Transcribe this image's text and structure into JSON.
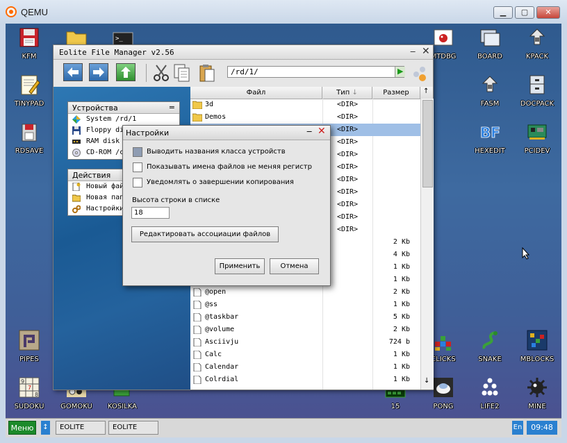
{
  "host": {
    "title": "QEMU",
    "min_glyph": "▁",
    "max_glyph": "▢",
    "close_glyph": "✕"
  },
  "desktop_icons": [
    {
      "label": "KFM",
      "icon": "floppy-icon"
    },
    {
      "label": "TINYPAD",
      "icon": "notepad-icon"
    },
    {
      "label": "RDSAVE",
      "icon": "save-icon"
    },
    {
      "label": "PIPES",
      "icon": "pipes-icon"
    },
    {
      "label": "SUDOKU",
      "icon": "sudoku-icon"
    },
    {
      "label": "GOMOKU",
      "icon": "gomoku-icon"
    },
    {
      "label": "KOSILKA",
      "icon": "kosilka-icon"
    },
    {
      "label": "MTDBG",
      "icon": "debugger-icon"
    },
    {
      "label": "BOARD",
      "icon": "board-icon"
    },
    {
      "label": "KPACK",
      "icon": "kpack-icon"
    },
    {
      "label": "FASM",
      "icon": "fasm-icon"
    },
    {
      "label": "DOCPACK",
      "icon": "docpack-icon"
    },
    {
      "label": "HEXEDIT",
      "icon": "hexedit-icon"
    },
    {
      "label": "PCIDEV",
      "icon": "pcidev-icon"
    },
    {
      "label": "CLICKS",
      "icon": "clicks-icon"
    },
    {
      "label": "SNAKE",
      "icon": "snake-icon"
    },
    {
      "label": "MBLOCKS",
      "icon": "mblocks-icon"
    },
    {
      "label": "15",
      "icon": "fifteen-icon"
    },
    {
      "label": "PONG",
      "icon": "pong-icon"
    },
    {
      "label": "LIFE2",
      "icon": "life-icon"
    },
    {
      "label": "MINE",
      "icon": "mine-icon"
    }
  ],
  "fm": {
    "title": "Eolite File Manager v2.56",
    "min_glyph": "‒",
    "close_glyph": "✕",
    "path": "/rd/1/",
    "devices": {
      "header": "Устройства",
      "menu_glyph": "=",
      "items": [
        {
          "label": "System /rd/1",
          "icon": "system-icon"
        },
        {
          "label": "Floppy disk",
          "icon": "floppy-icon"
        },
        {
          "label": "RAM disk",
          "icon": "ramdisk-icon"
        },
        {
          "label": "CD-ROM /cd",
          "icon": "cdrom-icon"
        }
      ]
    },
    "actions": {
      "header": "Действия",
      "items": [
        {
          "label": "Новый файл",
          "icon": "new-file-icon"
        },
        {
          "label": "Новая папка",
          "icon": "new-folder-icon"
        },
        {
          "label": "Настройки",
          "icon": "settings-icon"
        }
      ]
    },
    "columns": {
      "name": "Файл",
      "type": "Тип",
      "sort_glyph": "↓",
      "size": "Размер"
    },
    "scroll_up": "↑",
    "scroll_down": "↓",
    "files": [
      {
        "name": "3d",
        "type": "<DIR>",
        "size": "",
        "kind": "folder",
        "selected": false
      },
      {
        "name": "Demos",
        "type": "<DIR>",
        "size": "",
        "kind": "folder",
        "selected": false
      },
      {
        "name": "",
        "type": "<DIR>",
        "size": "",
        "kind": "folder",
        "selected": true
      },
      {
        "name": "",
        "type": "<DIR>",
        "size": "",
        "kind": "folder",
        "selected": false
      },
      {
        "name": "",
        "type": "<DIR>",
        "size": "",
        "kind": "folder",
        "selected": false
      },
      {
        "name": "",
        "type": "<DIR>",
        "size": "",
        "kind": "folder",
        "selected": false
      },
      {
        "name": "",
        "type": "<DIR>",
        "size": "",
        "kind": "folder",
        "selected": false
      },
      {
        "name": "",
        "type": "<DIR>",
        "size": "",
        "kind": "folder",
        "selected": false
      },
      {
        "name": "",
        "type": "<DIR>",
        "size": "",
        "kind": "folder",
        "selected": false
      },
      {
        "name": "",
        "type": "<DIR>",
        "size": "",
        "kind": "folder",
        "selected": false
      },
      {
        "name": "",
        "type": "<DIR>",
        "size": "",
        "kind": "folder",
        "selected": false
      },
      {
        "name": "",
        "type": "",
        "size": "2 Kb",
        "kind": "file",
        "selected": false
      },
      {
        "name": "",
        "type": "",
        "size": "4 Kb",
        "kind": "file",
        "selected": false
      },
      {
        "name": "",
        "type": "",
        "size": "1 Kb",
        "kind": "file",
        "selected": false
      },
      {
        "name": "",
        "type": "",
        "size": "1 Kb",
        "kind": "file",
        "selected": false
      },
      {
        "name": "@open",
        "type": "",
        "size": "2 Kb",
        "kind": "file",
        "selected": false
      },
      {
        "name": "@ss",
        "type": "",
        "size": "1 Kb",
        "kind": "file",
        "selected": false
      },
      {
        "name": "@taskbar",
        "type": "",
        "size": "5 Kb",
        "kind": "file",
        "selected": false
      },
      {
        "name": "@volume",
        "type": "",
        "size": "2 Kb",
        "kind": "file",
        "selected": false
      },
      {
        "name": "Asciivju",
        "type": "",
        "size": "724 b",
        "kind": "file",
        "selected": false
      },
      {
        "name": "Calc",
        "type": "",
        "size": "1 Kb",
        "kind": "file",
        "selected": false
      },
      {
        "name": "Calendar",
        "type": "",
        "size": "1 Kb",
        "kind": "file",
        "selected": false
      },
      {
        "name": "Colrdial",
        "type": "",
        "size": "1 Kb",
        "kind": "file",
        "selected": false
      }
    ]
  },
  "dialog": {
    "title": "Настройки",
    "min_glyph": "‒",
    "close_glyph": "✕",
    "options": [
      {
        "label": "Выводить названия класса устройств",
        "checked": true
      },
      {
        "label": "Показывать имена файлов не меняя регистр",
        "checked": false
      },
      {
        "label": "Уведомлять о завершении копирования",
        "checked": false
      }
    ],
    "row_height_label": "Высота строки в списке",
    "row_height_value": "18",
    "assoc_button": "Редактировать ассоциации файлов",
    "apply_button": "Применить",
    "cancel_button": "Отмена"
  },
  "taskbar": {
    "menu": "Меню",
    "switch_glyph": "↕",
    "tasks": [
      "EOLITE",
      "EOLITE"
    ],
    "lang": "En",
    "clock": "09:48"
  },
  "colors": {
    "accent": "#2a80d0",
    "menu_green": "#1c8a2a",
    "selection": "#9fbfe6",
    "dialog_close": "#cc1a1a"
  }
}
